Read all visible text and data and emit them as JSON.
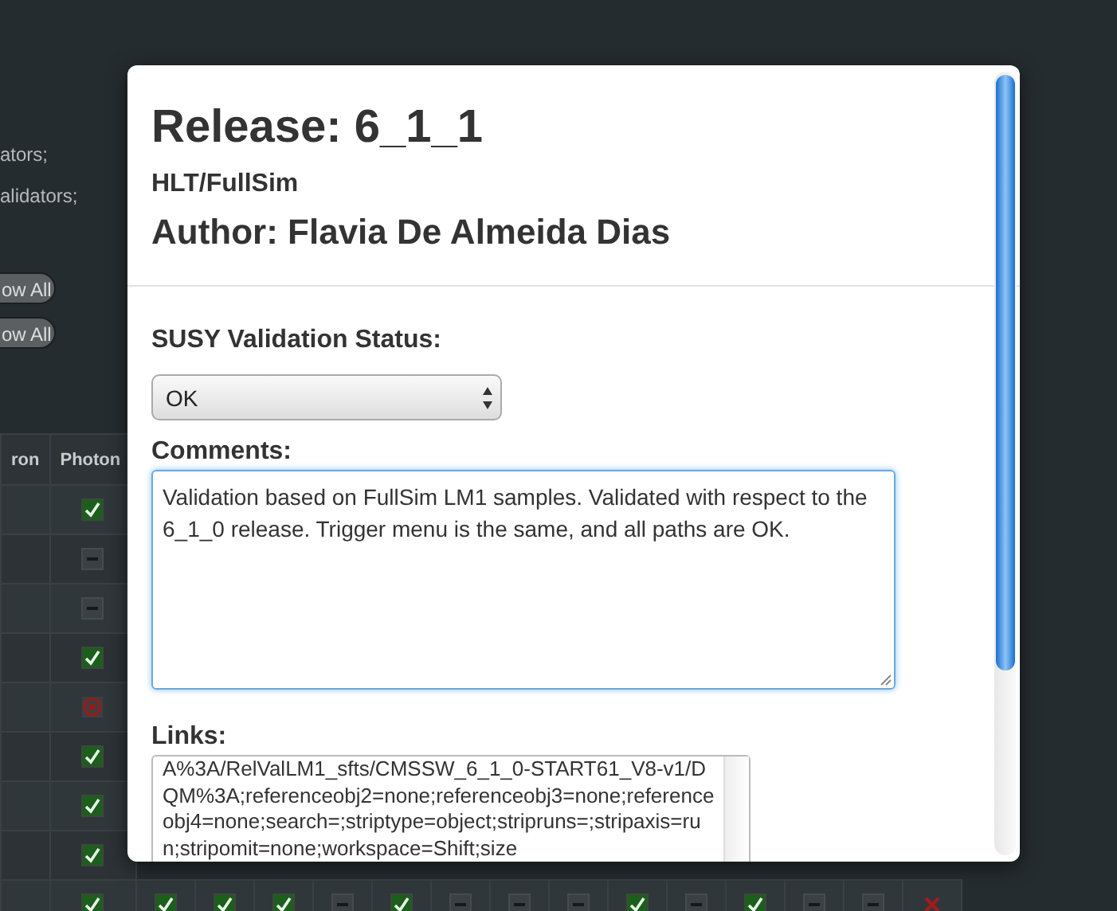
{
  "background": {
    "texts": [
      "ators;",
      "alidators;"
    ],
    "buttons": [
      "ow All",
      "ow All"
    ],
    "table": {
      "columns": [
        "ron",
        "Photon"
      ],
      "rows": [
        {
          "cells": [
            {
              "kind": "check"
            }
          ]
        },
        {
          "cells": [
            {
              "kind": "dash"
            }
          ]
        },
        {
          "cells": [
            {
              "kind": "dash"
            }
          ]
        },
        {
          "cells": [
            {
              "kind": "check"
            }
          ]
        },
        {
          "cells": [
            {
              "kind": "target"
            }
          ]
        },
        {
          "cells": [
            {
              "kind": "check"
            }
          ]
        },
        {
          "cells": [
            {
              "kind": "check"
            }
          ]
        },
        {
          "cells": [
            {
              "kind": "check"
            }
          ]
        },
        {
          "cells": [
            {
              "kind": "check"
            },
            {
              "kind": "check"
            },
            {
              "kind": "check"
            },
            {
              "kind": "check"
            },
            {
              "kind": "dash"
            },
            {
              "kind": "check"
            },
            {
              "kind": "dash"
            },
            {
              "kind": "dash"
            },
            {
              "kind": "dash"
            },
            {
              "kind": "check"
            },
            {
              "kind": "dash"
            },
            {
              "kind": "check"
            },
            {
              "kind": "dash"
            },
            {
              "kind": "dash"
            },
            {
              "kind": "cross"
            }
          ]
        }
      ]
    }
  },
  "dialog": {
    "title": "Release: 6_1_1",
    "subtitle": "HLT/FullSim",
    "author": "Author: Flavia De Almeida Dias",
    "status_label": "SUSY Validation Status:",
    "status_value": "OK",
    "comments_label": "Comments:",
    "comments": "Validation based on FullSim LM1 samples. Validated with respect to the 6_1_0 release. Trigger menu is the same, and all paths are OK.",
    "links_label": "Links:",
    "links": "A%3A/RelValLM1_sfts/CMSSW_6_1_0-START61_V8-v1/DQM%3A;referenceobj2=none;referenceobj3=none;referenceobj4=none;search=;striptype=object;stripruns=;stripaxis=run;stripomit=none;workspace=Shift;size"
  }
}
